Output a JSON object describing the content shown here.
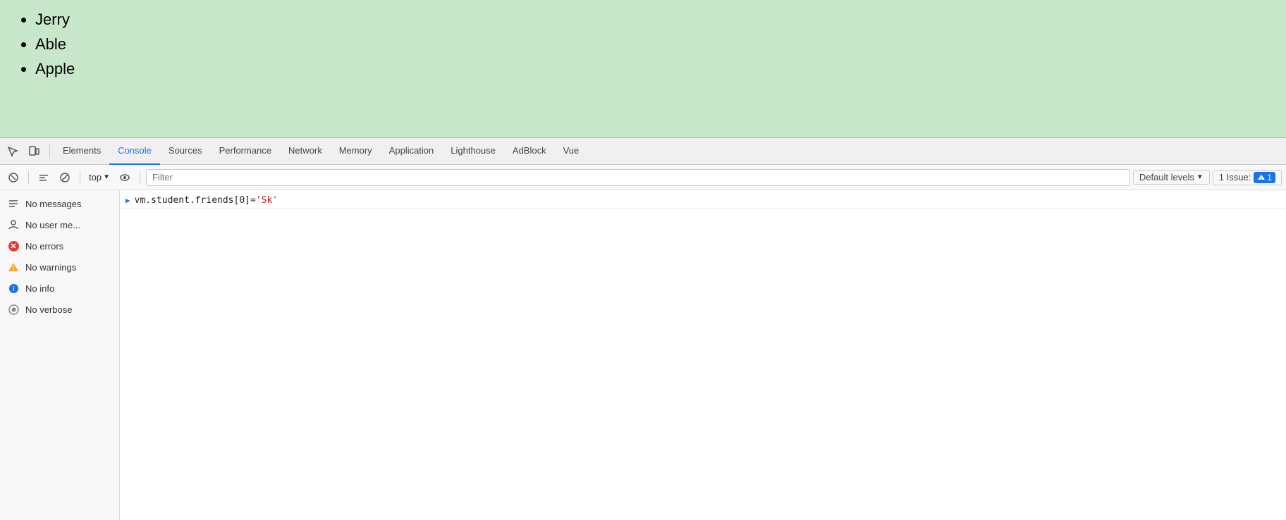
{
  "page": {
    "list_items": [
      "Jerry",
      "Able",
      "Apple"
    ]
  },
  "devtools": {
    "tabs": [
      {
        "id": "elements",
        "label": "Elements",
        "active": false
      },
      {
        "id": "console",
        "label": "Console",
        "active": true
      },
      {
        "id": "sources",
        "label": "Sources",
        "active": false
      },
      {
        "id": "performance",
        "label": "Performance",
        "active": false
      },
      {
        "id": "network",
        "label": "Network",
        "active": false
      },
      {
        "id": "memory",
        "label": "Memory",
        "active": false
      },
      {
        "id": "application",
        "label": "Application",
        "active": false
      },
      {
        "id": "lighthouse",
        "label": "Lighthouse",
        "active": false
      },
      {
        "id": "adblock",
        "label": "AdBlock",
        "active": false
      },
      {
        "id": "vue",
        "label": "Vue",
        "active": false
      }
    ],
    "toolbar": {
      "top_label": "top",
      "filter_placeholder": "Filter",
      "default_levels_label": "Default levels",
      "issues_label": "1 Issue:",
      "issues_count": "1"
    },
    "sidebar": {
      "items": [
        {
          "id": "messages",
          "label": "No messages",
          "icon": "messages"
        },
        {
          "id": "user",
          "label": "No user me...",
          "icon": "user"
        },
        {
          "id": "errors",
          "label": "No errors",
          "icon": "error"
        },
        {
          "id": "warnings",
          "label": "No warnings",
          "icon": "warning"
        },
        {
          "id": "info",
          "label": "No info",
          "icon": "info"
        },
        {
          "id": "verbose",
          "label": "No verbose",
          "icon": "verbose"
        }
      ]
    },
    "console_entries": [
      {
        "id": "entry1",
        "type": "result",
        "code_prefix": "vm.student.friends[0]=",
        "code_string": "'Sk'"
      }
    ]
  }
}
